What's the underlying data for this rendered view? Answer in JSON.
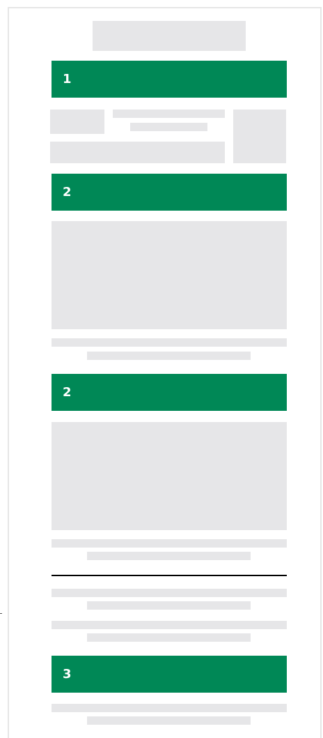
{
  "colors": {
    "step_bar": "#008856",
    "placeholder": "#e6e6e8",
    "divider": "#000000",
    "frame_border": "#e6e6e6"
  },
  "steps": [
    {
      "number": "1"
    },
    {
      "number": "2"
    },
    {
      "number": "2"
    },
    {
      "number": "3"
    }
  ]
}
